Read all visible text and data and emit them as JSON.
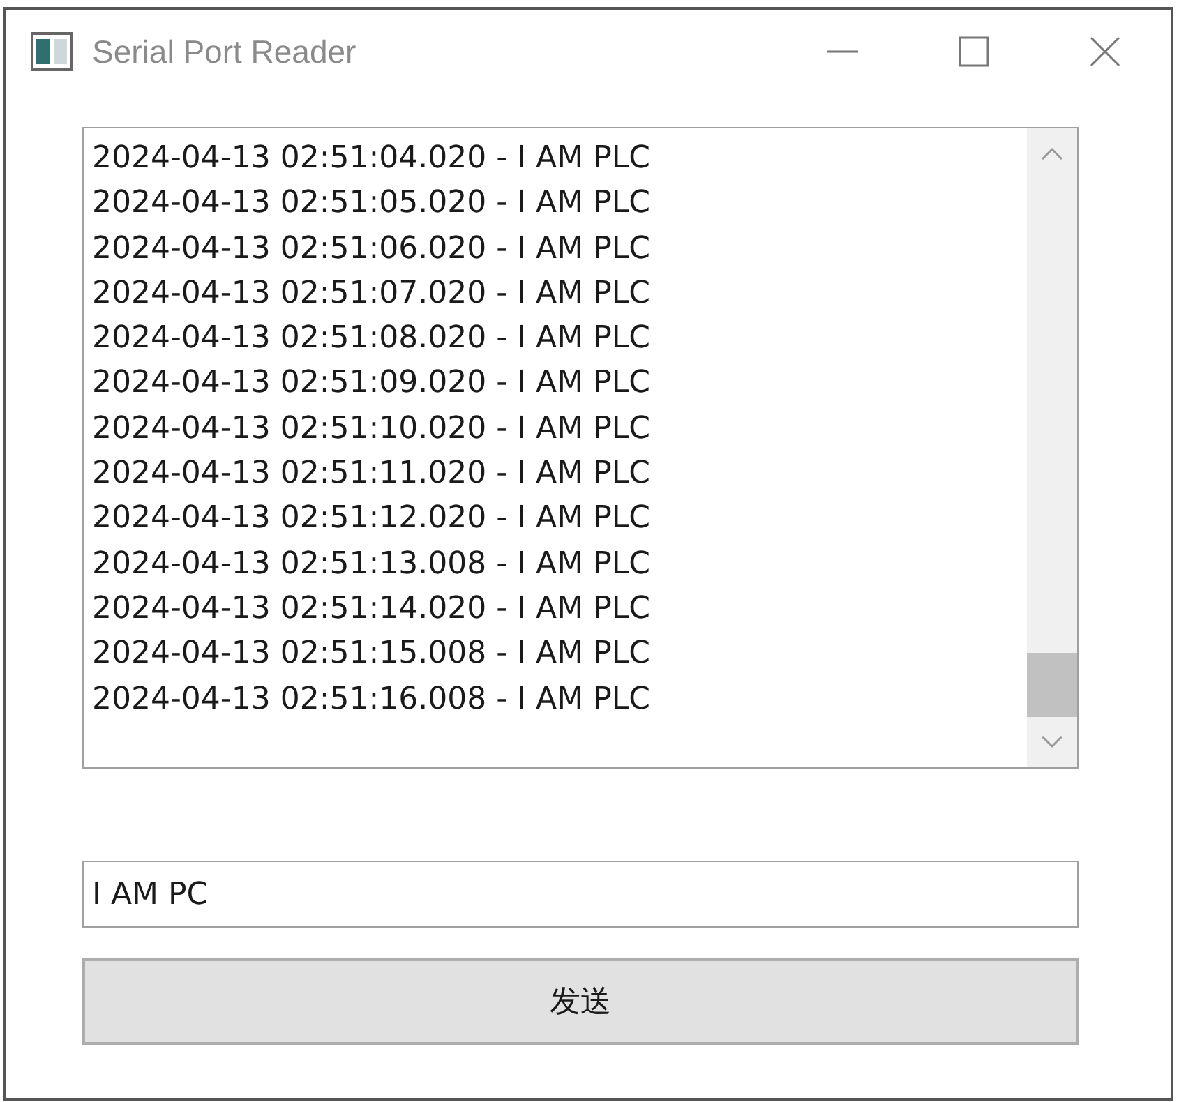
{
  "window": {
    "title": "Serial Port Reader"
  },
  "log": {
    "lines": [
      "2024-04-13 02:51:04.020 - I AM PLC",
      "2024-04-13 02:51:05.020 - I AM PLC",
      "2024-04-13 02:51:06.020 - I AM PLC",
      "2024-04-13 02:51:07.020 - I AM PLC",
      "2024-04-13 02:51:08.020 - I AM PLC",
      "2024-04-13 02:51:09.020 - I AM PLC",
      "2024-04-13 02:51:10.020 - I AM PLC",
      "2024-04-13 02:51:11.020 - I AM PLC",
      "2024-04-13 02:51:12.020 - I AM PLC",
      "2024-04-13 02:51:13.008 - I AM PLC",
      "2024-04-13 02:51:14.020 - I AM PLC",
      "2024-04-13 02:51:15.008 - I AM PLC",
      "2024-04-13 02:51:16.008 - I AM PLC"
    ]
  },
  "message_input": {
    "value": "I AM PC"
  },
  "send_button": {
    "label": "发送"
  }
}
